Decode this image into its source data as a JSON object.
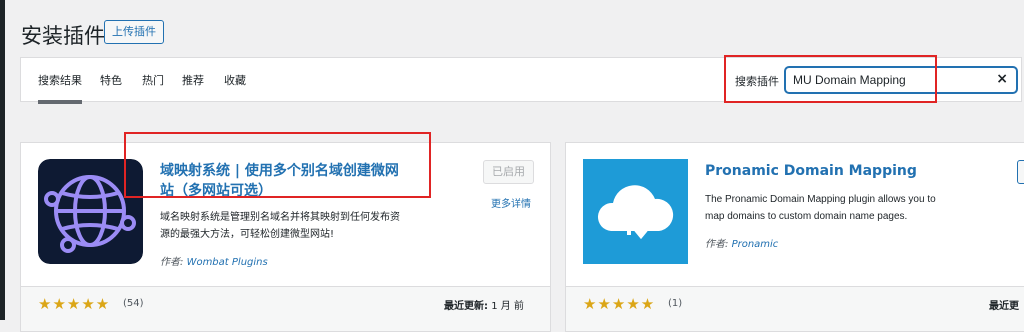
{
  "header": {
    "title": "安装插件",
    "upload_button": "上传插件"
  },
  "filter": {
    "tabs": [
      "搜索结果",
      "特色",
      "热门",
      "推荐",
      "收藏"
    ],
    "search_label": "搜索插件",
    "search_value": "MU Domain Mapping",
    "clear_icon": "×"
  },
  "cards": [
    {
      "name_line1": "域映射系统 | 使用多个别名域创建微网",
      "name_line2": "站（多网站可选）",
      "description_line1": "域名映射系统是管理别名域名并将其映射到任何发布资",
      "description_line2": "源的最强大方法，可轻松创建微型网站!",
      "author_label": "作者:",
      "author": "Wombat Plugins",
      "action_button": "已启用",
      "more_details": "更多详情",
      "stars": "★★★★★",
      "rating_count": "(54)",
      "updated_label": "最近更新:",
      "updated_value": "1 月 前"
    },
    {
      "name": "Pronamic Domain Mapping",
      "description_line1": "The Pronamic Domain Mapping plugin allows you to",
      "description_line2": "map domains to custom domain name pages.",
      "author_label": "作者:",
      "author": "Pronamic",
      "stars": "★★★★★",
      "rating_count": "(1)",
      "updated_label": "最近更"
    }
  ],
  "colors": {
    "accent": "#2271b1",
    "highlight": "#e02424",
    "star": "#dba617"
  }
}
